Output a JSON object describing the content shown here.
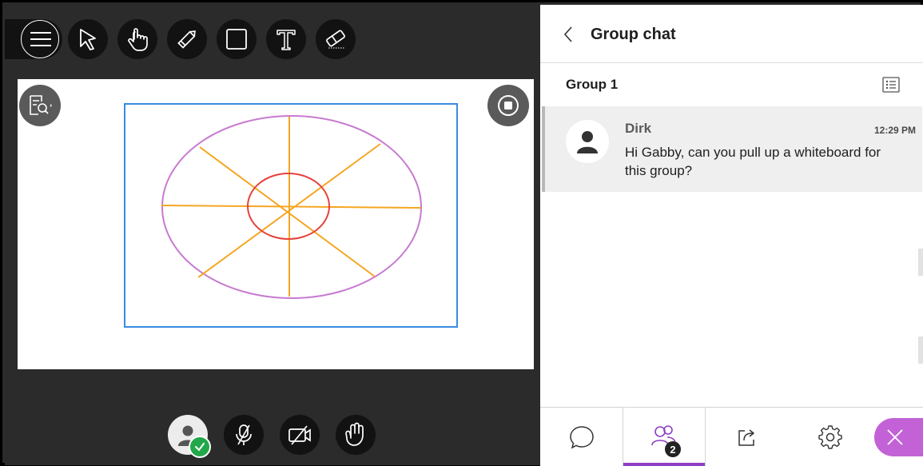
{
  "chat": {
    "title": "Group chat",
    "group_name": "Group 1",
    "messages": [
      {
        "author": "Dirk",
        "time": "12:29 PM",
        "text": "Hi Gabby, can you pull up a whiteboard for this group?"
      }
    ]
  },
  "footer": {
    "attendee_count": "2"
  },
  "toolbar": {
    "tools": [
      "menu-icon",
      "select-icon",
      "pointer-hand-icon",
      "pencil-icon",
      "rectangle-icon",
      "text-icon",
      "eraser-icon"
    ]
  },
  "colors": {
    "accent_purple": "#c362d6",
    "active_tab_underline": "#8e3fc2",
    "status_green": "#22a84a",
    "board_frame_blue": "#3a8be0"
  }
}
